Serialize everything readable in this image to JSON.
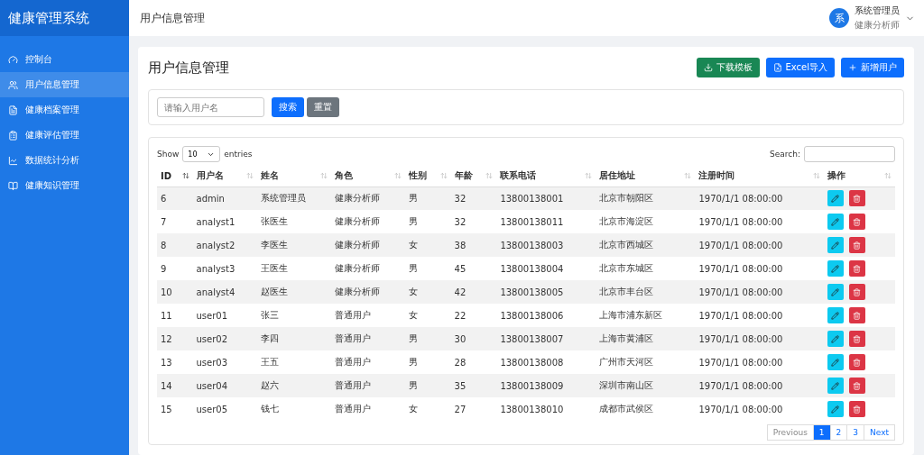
{
  "sidebar": {
    "brand": "健康管理系统",
    "items": [
      {
        "label": "控制台",
        "selected": false
      },
      {
        "label": "用户信息管理",
        "selected": true
      },
      {
        "label": "健康档案管理",
        "selected": false
      },
      {
        "label": "健康评估管理",
        "selected": false
      },
      {
        "label": "数据统计分析",
        "selected": false
      },
      {
        "label": "健康知识管理",
        "selected": false
      }
    ]
  },
  "topbar": {
    "title": "用户信息管理",
    "user": {
      "avatar": "系",
      "name": "系统管理员",
      "role": "健康分析师"
    }
  },
  "page": {
    "title": "用户信息管理",
    "actions": [
      {
        "label": "下载模板",
        "kind": "download"
      },
      {
        "label": "Excel导入",
        "kind": "import"
      },
      {
        "label": "新增用户",
        "kind": "add"
      }
    ]
  },
  "filter": {
    "placeholder": "请输入用户名",
    "search": "搜索",
    "reset": "重置"
  },
  "table": {
    "show": "Show",
    "length": "10",
    "entries": "entries",
    "search_label": "Search:",
    "columns": [
      {
        "label": "ID",
        "sorted": true
      },
      {
        "label": "用户名",
        "sorted": false
      },
      {
        "label": "姓名",
        "sorted": false
      },
      {
        "label": "角色",
        "sorted": false
      },
      {
        "label": "性别",
        "sorted": false
      },
      {
        "label": "年龄",
        "sorted": false
      },
      {
        "label": "联系电话",
        "sorted": false
      },
      {
        "label": "居住地址",
        "sorted": false
      },
      {
        "label": "注册时间",
        "sorted": false
      },
      {
        "label": "操作",
        "sorted": false
      }
    ],
    "rows": [
      [
        "6",
        "admin",
        "系统管理员",
        "健康分析师",
        "男",
        "32",
        "13800138001",
        "北京市朝阳区",
        "1970/1/1 08:00:00"
      ],
      [
        "7",
        "analyst1",
        "张医生",
        "健康分析师",
        "男",
        "32",
        "13800138011",
        "北京市海淀区",
        "1970/1/1 08:00:00"
      ],
      [
        "8",
        "analyst2",
        "李医生",
        "健康分析师",
        "女",
        "38",
        "13800138003",
        "北京市西城区",
        "1970/1/1 08:00:00"
      ],
      [
        "9",
        "analyst3",
        "王医生",
        "健康分析师",
        "男",
        "45",
        "13800138004",
        "北京市东城区",
        "1970/1/1 08:00:00"
      ],
      [
        "10",
        "analyst4",
        "赵医生",
        "健康分析师",
        "女",
        "42",
        "13800138005",
        "北京市丰台区",
        "1970/1/1 08:00:00"
      ],
      [
        "11",
        "user01",
        "张三",
        "普通用户",
        "女",
        "22",
        "13800138006",
        "上海市浦东新区",
        "1970/1/1 08:00:00"
      ],
      [
        "12",
        "user02",
        "李四",
        "普通用户",
        "男",
        "30",
        "13800138007",
        "上海市黄浦区",
        "1970/1/1 08:00:00"
      ],
      [
        "13",
        "user03",
        "王五",
        "普通用户",
        "男",
        "28",
        "13800138008",
        "广州市天河区",
        "1970/1/1 08:00:00"
      ],
      [
        "14",
        "user04",
        "赵六",
        "普通用户",
        "男",
        "35",
        "13800138009",
        "深圳市南山区",
        "1970/1/1 08:00:00"
      ],
      [
        "15",
        "user05",
        "钱七",
        "普通用户",
        "女",
        "27",
        "13800138010",
        "成都市武侯区",
        "1970/1/1 08:00:00"
      ]
    ],
    "pagination": [
      {
        "label": "Previous",
        "selected": false
      },
      {
        "label": "1",
        "selected": true
      },
      {
        "label": "2",
        "selected": false
      },
      {
        "label": "3",
        "selected": false
      },
      {
        "label": "Next",
        "selected": false
      }
    ]
  }
}
